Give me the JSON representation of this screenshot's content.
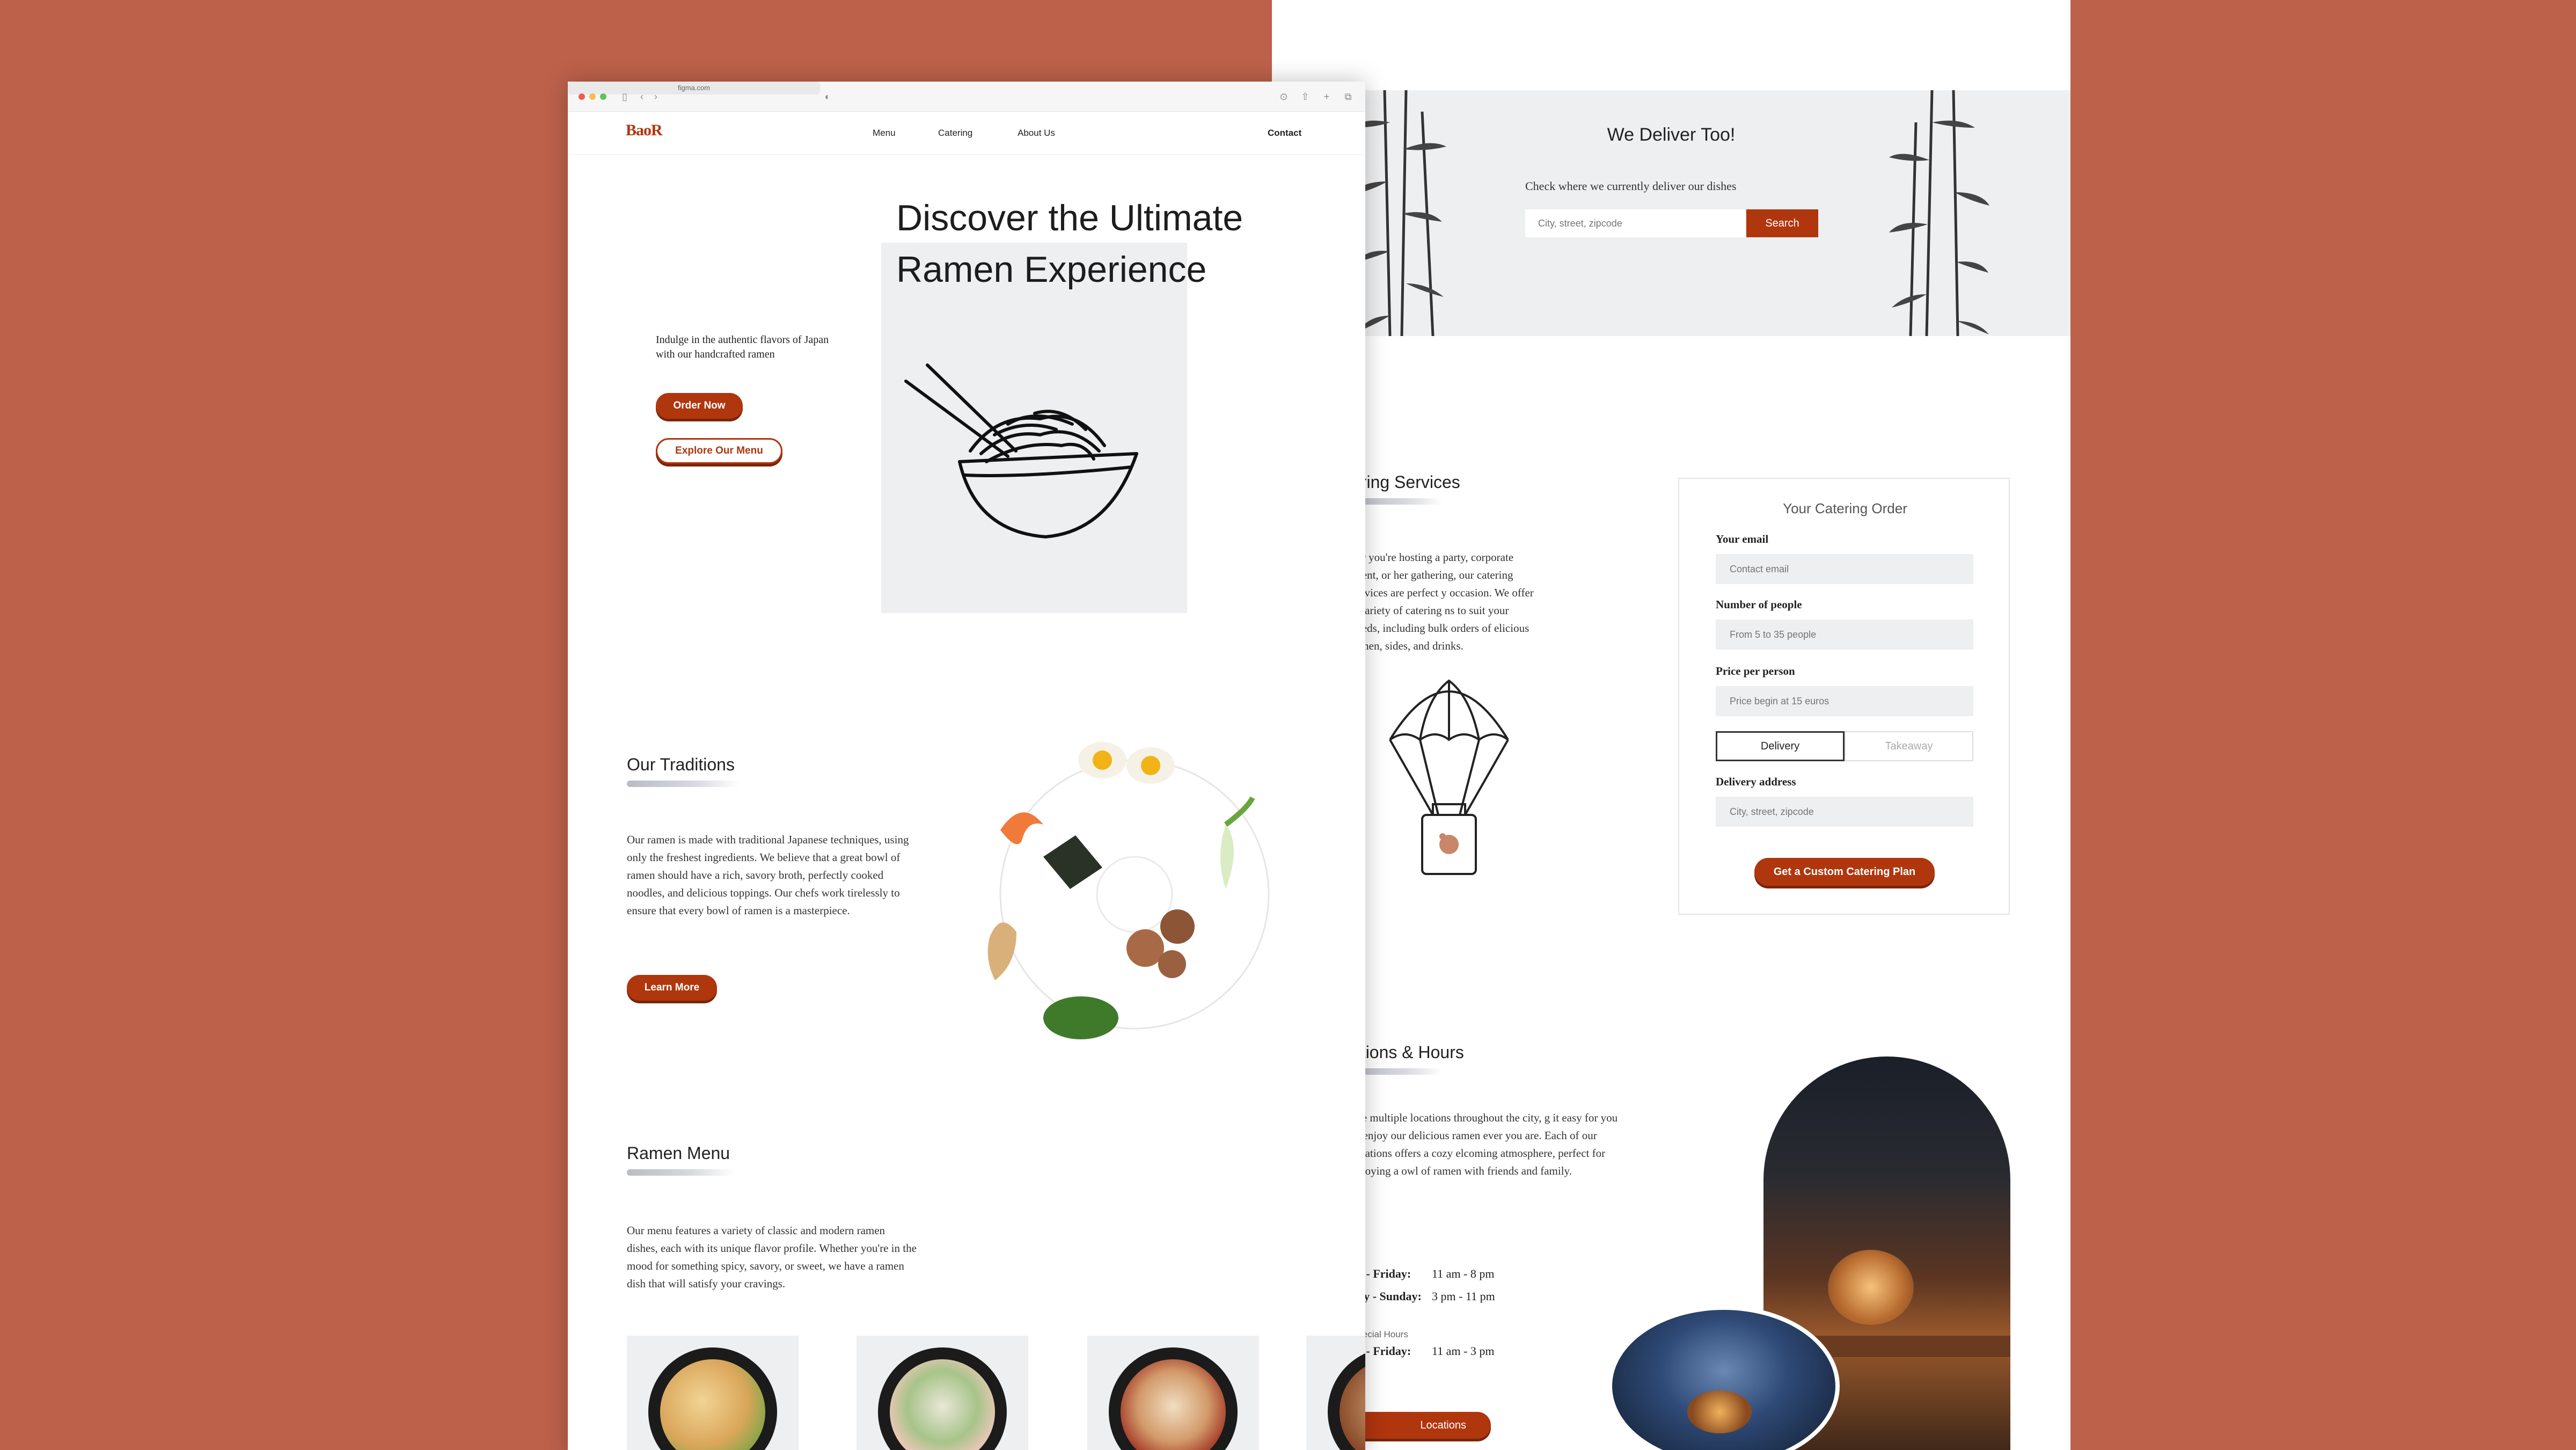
{
  "colors": {
    "background": "#bd614b",
    "accent": "#b0360e",
    "panel": "#eeeff0"
  },
  "browser": {
    "url": "figma.com"
  },
  "nav": {
    "logo": "BaoR",
    "links": [
      "Menu",
      "Catering",
      "About Us"
    ],
    "contact": "Contact"
  },
  "hero": {
    "title_line1": "Discover the Ultimate",
    "title_line2": "Ramen Experience",
    "text": "Indulge in the authentic flavors of Japan with our handcrafted ramen",
    "order_now": "Order Now",
    "explore_menu": "Explore Our Menu",
    "image_icon": "ramen-bowl-illustration"
  },
  "traditions": {
    "title": "Our Traditions",
    "text": "Our ramen is made with traditional Japanese techniques, using only the freshest ingredients. We believe that a great bowl of ramen should have a rich, savory broth, perfectly cooked noodles, and delicious toppings. Our chefs work tirelessly to ensure that every bowl of ramen is a masterpiece.",
    "learn_more": "Learn More"
  },
  "menu": {
    "title": "Ramen Menu",
    "text": "Our menu features a variety of classic and modern ramen dishes, each with its unique flavor profile. Whether you're in the mood for something spicy, savory, or sweet, we have a ramen dish that will satisfy your cravings."
  },
  "delivery": {
    "title": "We Deliver Too!",
    "subtitle": "Check where we currently deliver our dishes",
    "placeholder": "City, street, zipcode",
    "search": "Search"
  },
  "catering": {
    "title": "ering Services",
    "text": "her you're hosting a party, corporate event, or her gathering, our catering services are perfect y occasion. We offer a variety of catering ns to suit your needs, including bulk orders of elicious ramen, sides, and drinks."
  },
  "order_form": {
    "title": "Your Catering Order",
    "email_label": "Your email",
    "email_placeholder": "Contact email",
    "people_label": "Number of people",
    "people_placeholder": "From 5 to 35 people",
    "price_label": "Price per person",
    "price_placeholder": "Price begin at 15 euros",
    "delivery_option": "Delivery",
    "takeaway_option": "Takeaway",
    "address_label": "Delivery address",
    "address_placeholder": "City, street, zipcode",
    "submit": "Get a Custom Catering Plan"
  },
  "locations": {
    "title": "ations & Hours",
    "text": "ave multiple locations throughout the city, g it easy for you to enjoy our delicious ramen ever you are. Each of our locations offers a cozy elcoming atmosphere, perfect for enjoying a owl of ramen with friends and family.",
    "hours_caption": "s",
    "row1_day": "ay - Friday:",
    "row1_time": "11 am - 8 pm",
    "row2_day": "day - Sunday:",
    "row2_time": "3 pm - 11 pm",
    "special_caption": "Special Hours",
    "row3_day": "ay - Friday:",
    "row3_time": "11 am - 3 pm",
    "button": "Locations"
  }
}
